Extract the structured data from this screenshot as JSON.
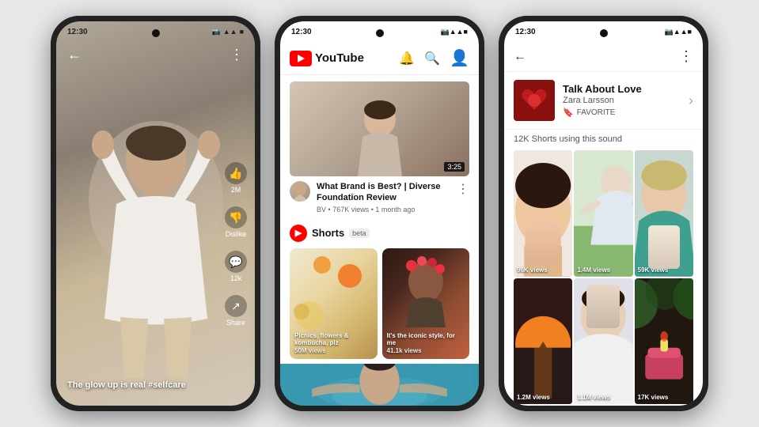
{
  "background": "#e0e0e0",
  "phone1": {
    "status_time": "12:30",
    "status_icons": "● ▲ ▲ ■",
    "caption": "The glow up is real #selfcare",
    "actions": [
      {
        "label": "2M",
        "icon": "👍"
      },
      {
        "label": "Dislike",
        "icon": "👎"
      },
      {
        "label": "12k",
        "icon": "💬"
      },
      {
        "label": "Share",
        "icon": "↗"
      }
    ]
  },
  "phone2": {
    "status_time": "12:30",
    "app_name": "YouTube",
    "video": {
      "title": "What Brand is Best? | Diverse Foundation Review",
      "channel": "BV",
      "views": "767K views",
      "time_ago": "1 month ago",
      "duration": "3:25"
    },
    "shorts": {
      "label": "Shorts",
      "badge": "beta",
      "items": [
        {
          "caption": "Picnics, flowers & kombucha, plz",
          "views": "50M views"
        },
        {
          "caption": "It's the iconic style, for me",
          "views": "41.1k views"
        }
      ]
    }
  },
  "phone3": {
    "status_time": "12:30",
    "song": {
      "title": "Talk About Love",
      "artist": "Zara Larsson",
      "favorite_label": "FAVORITE"
    },
    "sounds_count": "12K Shorts using this sound",
    "grid_items": [
      {
        "views": "96K views"
      },
      {
        "views": "1.4M views"
      },
      {
        "views": "59K views"
      },
      {
        "views": "1.2M views"
      },
      {
        "views": "1.1M views"
      },
      {
        "views": "17K views"
      }
    ]
  }
}
